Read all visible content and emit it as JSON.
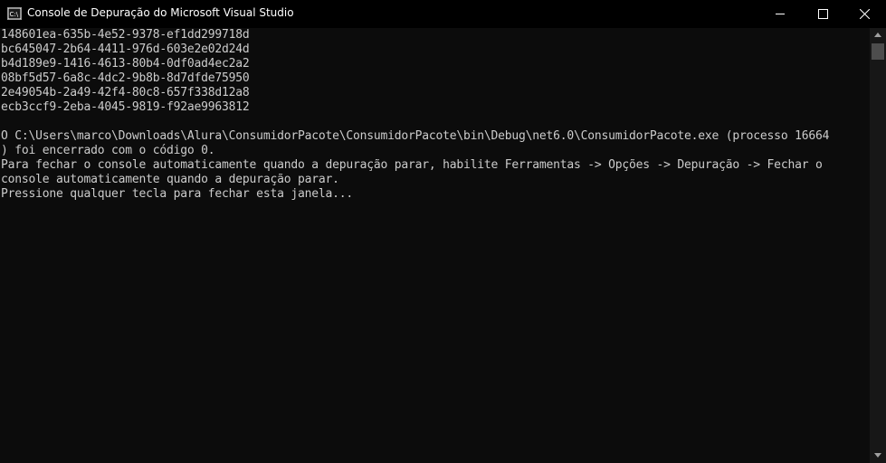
{
  "window": {
    "title": "Console de Depuração do Microsoft Visual Studio",
    "icon": "console-app-icon"
  },
  "controls": {
    "minimize": "minimize-icon",
    "maximize": "maximize-icon",
    "close": "close-icon"
  },
  "console": {
    "lines": [
      "148601ea-635b-4e52-9378-ef1dd299718d",
      "bc645047-2b64-4411-976d-603e2e02d24d",
      "b4d189e9-1416-4613-80b4-0df0ad4ec2a2",
      "08bf5d57-6a8c-4dc2-9b8b-8d7dfde75950",
      "2e49054b-2a49-42f4-80c8-657f338d12a8",
      "ecb3ccf9-2eba-4045-9819-f92ae9963812",
      "",
      "O C:\\Users\\marco\\Downloads\\Alura\\ConsumidorPacote\\ConsumidorPacote\\bin\\Debug\\net6.0\\ConsumidorPacote.exe (processo 16664",
      ") foi encerrado com o código 0.",
      "Para fechar o console automaticamente quando a depuração parar, habilite Ferramentas -> Opções -> Depuração -> Fechar o",
      "console automaticamente quando a depuração parar.",
      "Pressione qualquer tecla para fechar esta janela..."
    ]
  },
  "scrollbar": {
    "up": "scroll-up-arrow-icon",
    "down": "scroll-down-arrow-icon"
  }
}
